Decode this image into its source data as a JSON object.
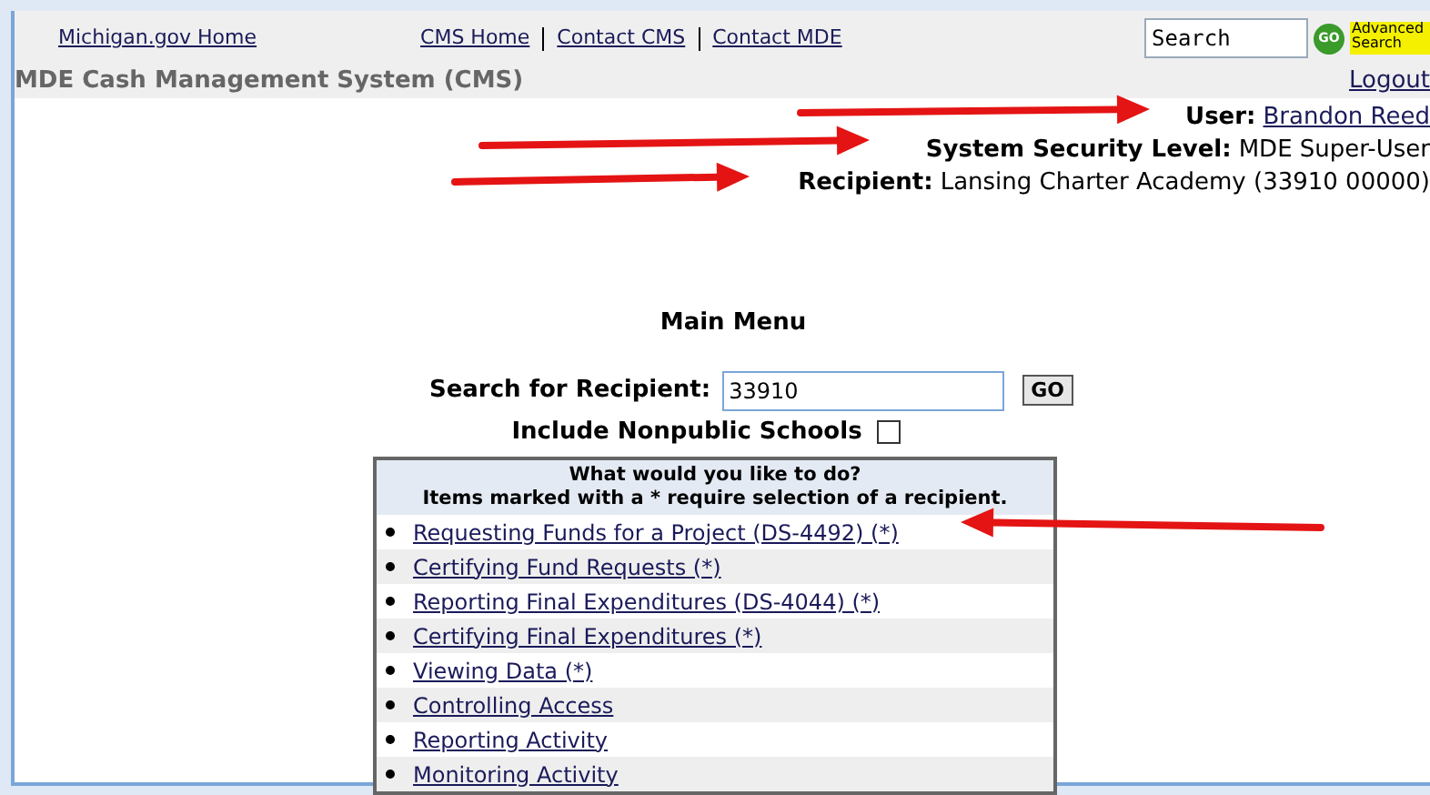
{
  "top_links": [
    {
      "label": "Michigan.gov Home"
    }
  ],
  "nav_links": [
    {
      "label": "CMS Home"
    },
    {
      "label": "Contact CMS"
    },
    {
      "label": "Contact MDE"
    }
  ],
  "site_search": {
    "placeholder": "Search",
    "button": "GO",
    "advanced": "Advanced Search"
  },
  "app_title": "MDE Cash Management System (CMS)",
  "logout": "Logout",
  "user_info": [
    {
      "label": "User:",
      "value": "Brandon Reed",
      "kind": "link"
    },
    {
      "label": "System Security Level:",
      "value": "MDE Super-User",
      "kind": "text"
    },
    {
      "label": "Recipient:",
      "value": "Lansing Charter Academy (33910 00000)",
      "kind": "text"
    }
  ],
  "main_menu": {
    "title": "Main Menu",
    "search_label": "Search for Recipient:",
    "search_value": "33910",
    "search_button": "GO",
    "nonpublic_label": "Include Nonpublic Schools",
    "nonpublic_checked": false,
    "header_lines": [
      "What would you like to do?",
      "Items marked with a * require selection of a recipient."
    ],
    "items": [
      {
        "label": "Requesting Funds for a Project (DS-4492) (*)"
      },
      {
        "label": "Certifying Fund Requests (*)"
      },
      {
        "label": "Reporting Final Expenditures (DS-4044) (*)"
      },
      {
        "label": "Certifying Final Expenditures (*)"
      },
      {
        "label": "Viewing Data (*)"
      },
      {
        "label": "Controlling Access"
      },
      {
        "label": "Reporting Activity"
      },
      {
        "label": "Monitoring Activity"
      }
    ]
  }
}
